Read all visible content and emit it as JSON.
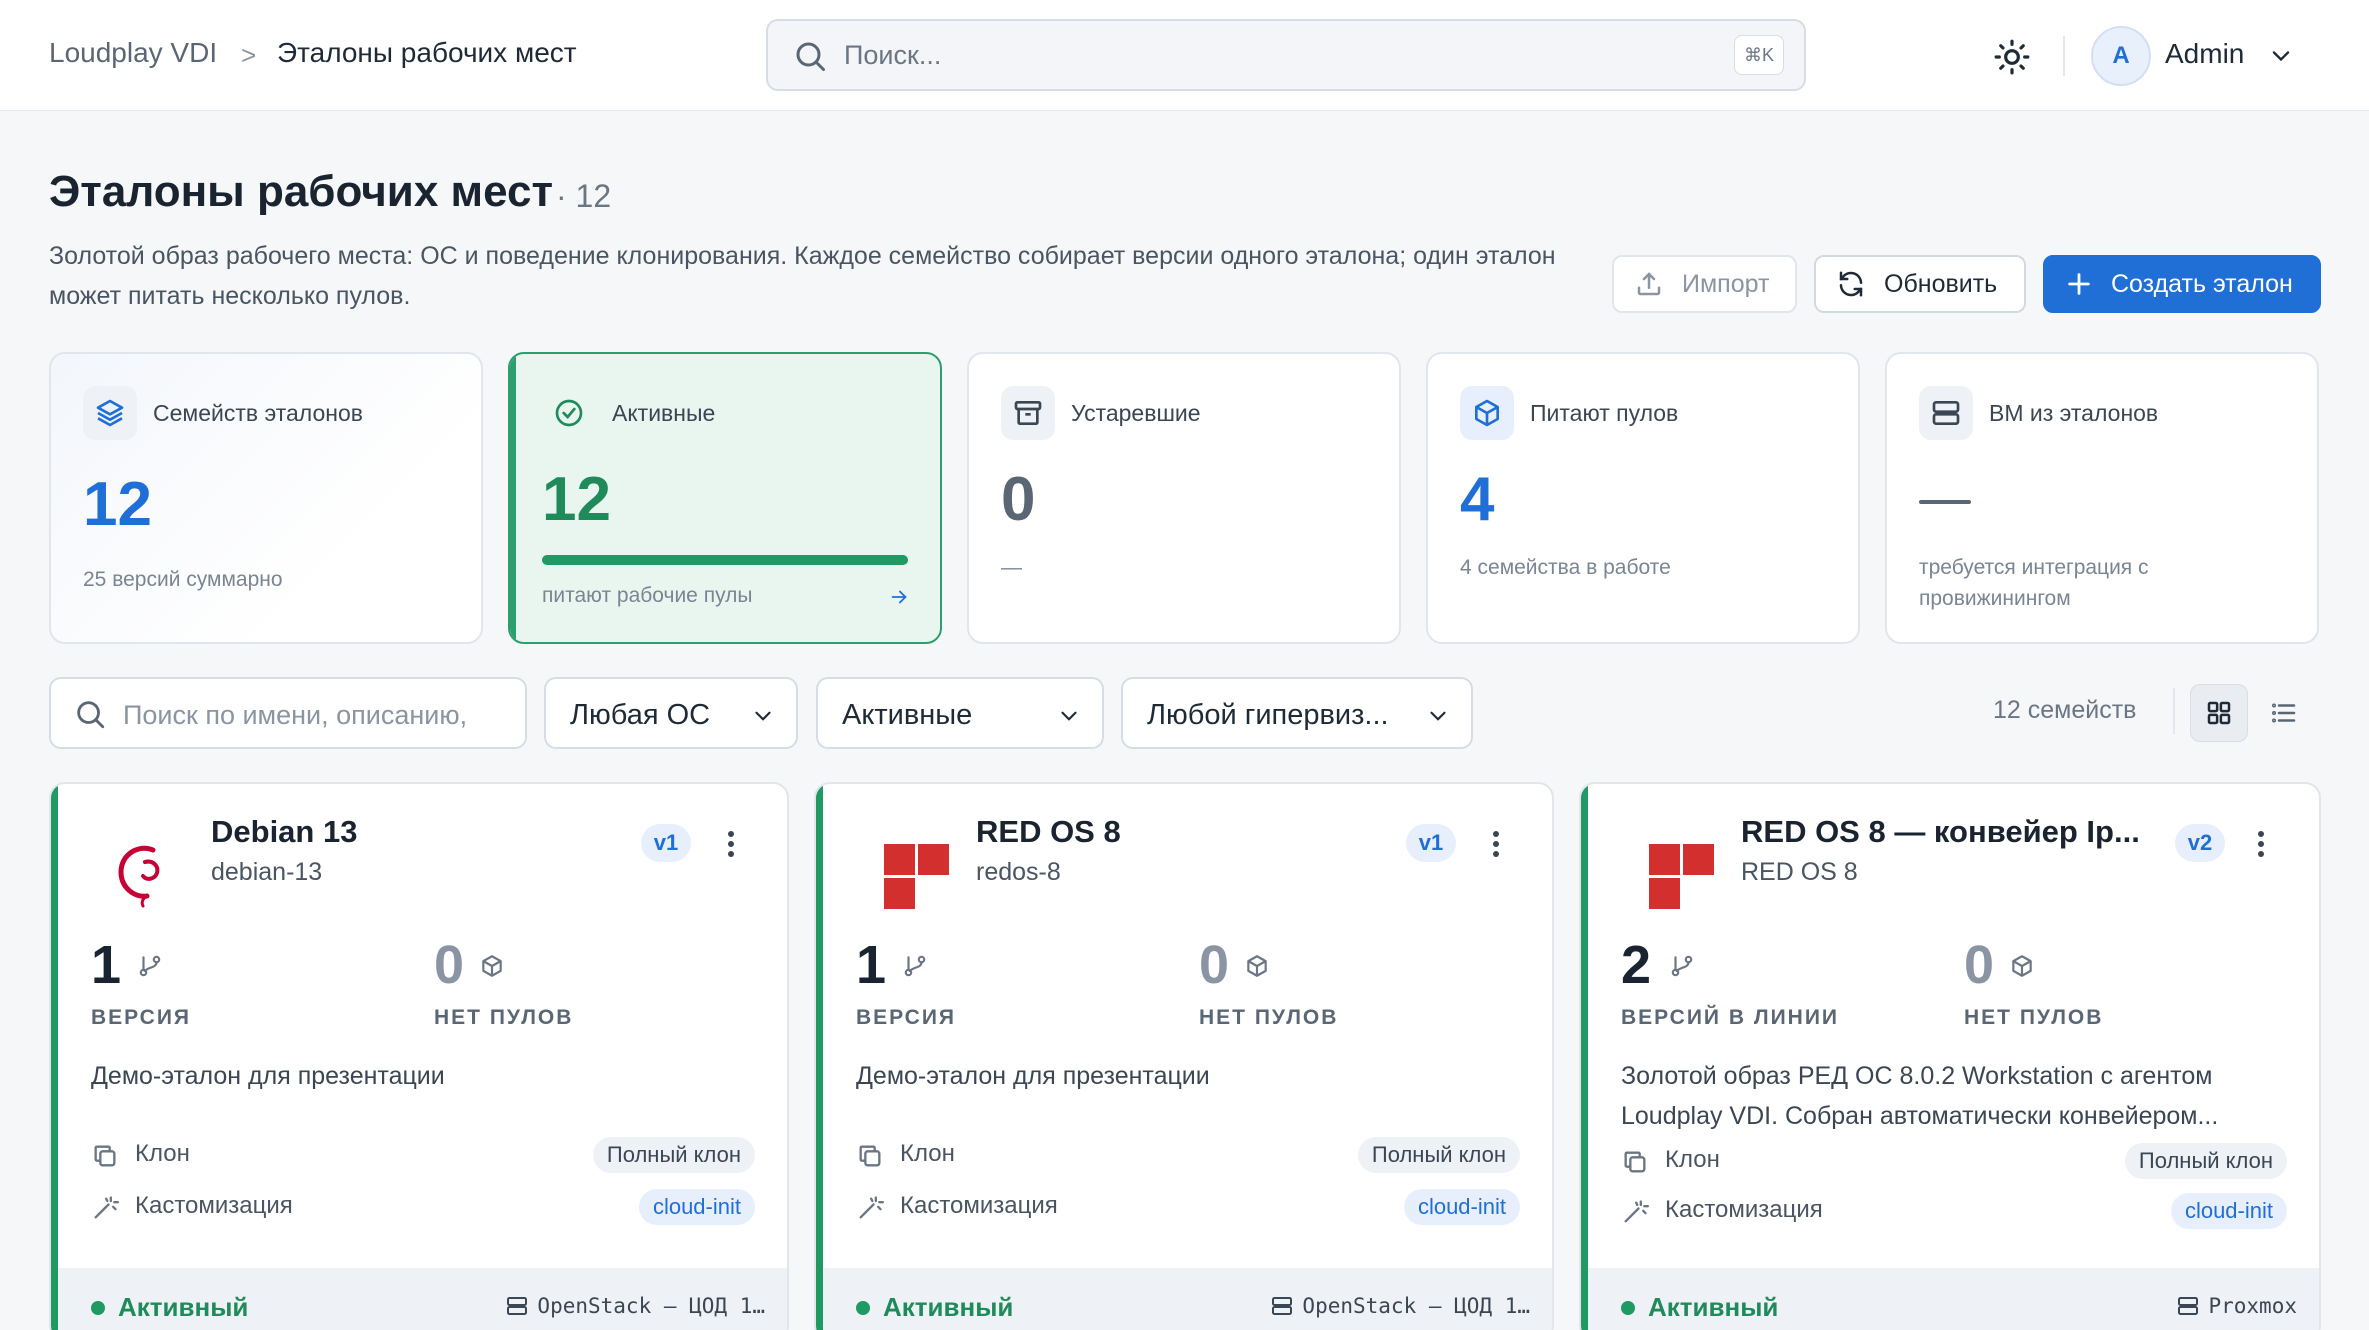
{
  "topbar": {
    "breadcrumb_root": "Loudplay VDI",
    "breadcrumb_sep": ">",
    "breadcrumb_current": "Эталоны рабочих мест",
    "search_placeholder": "Поиск...",
    "search_shortcut": "⌘K",
    "avatar_initial": "A",
    "user_name": "Admin"
  },
  "page": {
    "title": "Эталоны рабочих мест",
    "count": "· 12",
    "description": "Золотой образ рабочего места: ОС и поведение клонирования. Каждое семейство собирает версии одного эталона; один эталон может питать несколько пулов.",
    "import_label": "Импорт",
    "refresh_label": "Обновить",
    "create_label": "Создать эталон"
  },
  "stats": [
    {
      "label": "Семейств эталонов",
      "value": "12",
      "sub": "25 версий суммарно"
    },
    {
      "label": "Активные",
      "value": "12",
      "sub": "питают рабочие пулы",
      "progress": 1.0
    },
    {
      "label": "Устаревшие",
      "value": "0",
      "sub": "—"
    },
    {
      "label": "Питают пулов",
      "value": "4",
      "sub": "4 семейства в работе"
    },
    {
      "label": "ВМ из эталонов",
      "value": "—",
      "sub": "требуется интеграция с провижинингом"
    }
  ],
  "filters": {
    "search_placeholder": "Поиск по имени, описанию,",
    "os": "Любая ОС",
    "status": "Активные",
    "hypervisor": "Любой гипервиз...",
    "families_count": "12 семейств"
  },
  "cards": [
    {
      "name": "Debian 13",
      "slug": "debian-13",
      "version": "v1",
      "versions_num": "1",
      "versions_label": "ВЕРСИЯ",
      "pools_num": "0",
      "pools_label": "НЕТ ПУЛОВ",
      "description": "Демо-эталон для презентации",
      "clone_label": "Клон",
      "clone_value": "Полный клон",
      "custom_label": "Кастомизация",
      "custom_value": "cloud-init",
      "status": "Активный",
      "hypervisor": "OpenStack — ЦОД 1…"
    },
    {
      "name": "RED OS 8",
      "slug": "redos-8",
      "version": "v1",
      "versions_num": "1",
      "versions_label": "ВЕРСИЯ",
      "pools_num": "0",
      "pools_label": "НЕТ ПУЛОВ",
      "description": "Демо-эталон для презентации",
      "clone_label": "Клон",
      "clone_value": "Полный клон",
      "custom_label": "Кастомизация",
      "custom_value": "cloud-init",
      "status": "Активный",
      "hypervisor": "OpenStack — ЦОД 1…"
    },
    {
      "name": "RED OS 8 — конвейер Ip...",
      "slug": "RED OS 8",
      "version": "v2",
      "versions_num": "2",
      "versions_label": "ВЕРСИЙ В ЛИНИИ",
      "pools_num": "0",
      "pools_label": "НЕТ ПУЛОВ",
      "description": "Золотой образ РЕД ОС 8.0.2 Workstation с агентом Loudplay VDI. Собран автоматически конвейером...",
      "clone_label": "Клон",
      "clone_value": "Полный клон",
      "custom_label": "Кастомизация",
      "custom_value": "cloud-init",
      "status": "Активный",
      "hypervisor": "Proxmox"
    }
  ],
  "colors": {
    "accent": "#1f6fd6",
    "active": "#1f9a62",
    "redos": "#d32f2f",
    "debian": "#c70036"
  }
}
